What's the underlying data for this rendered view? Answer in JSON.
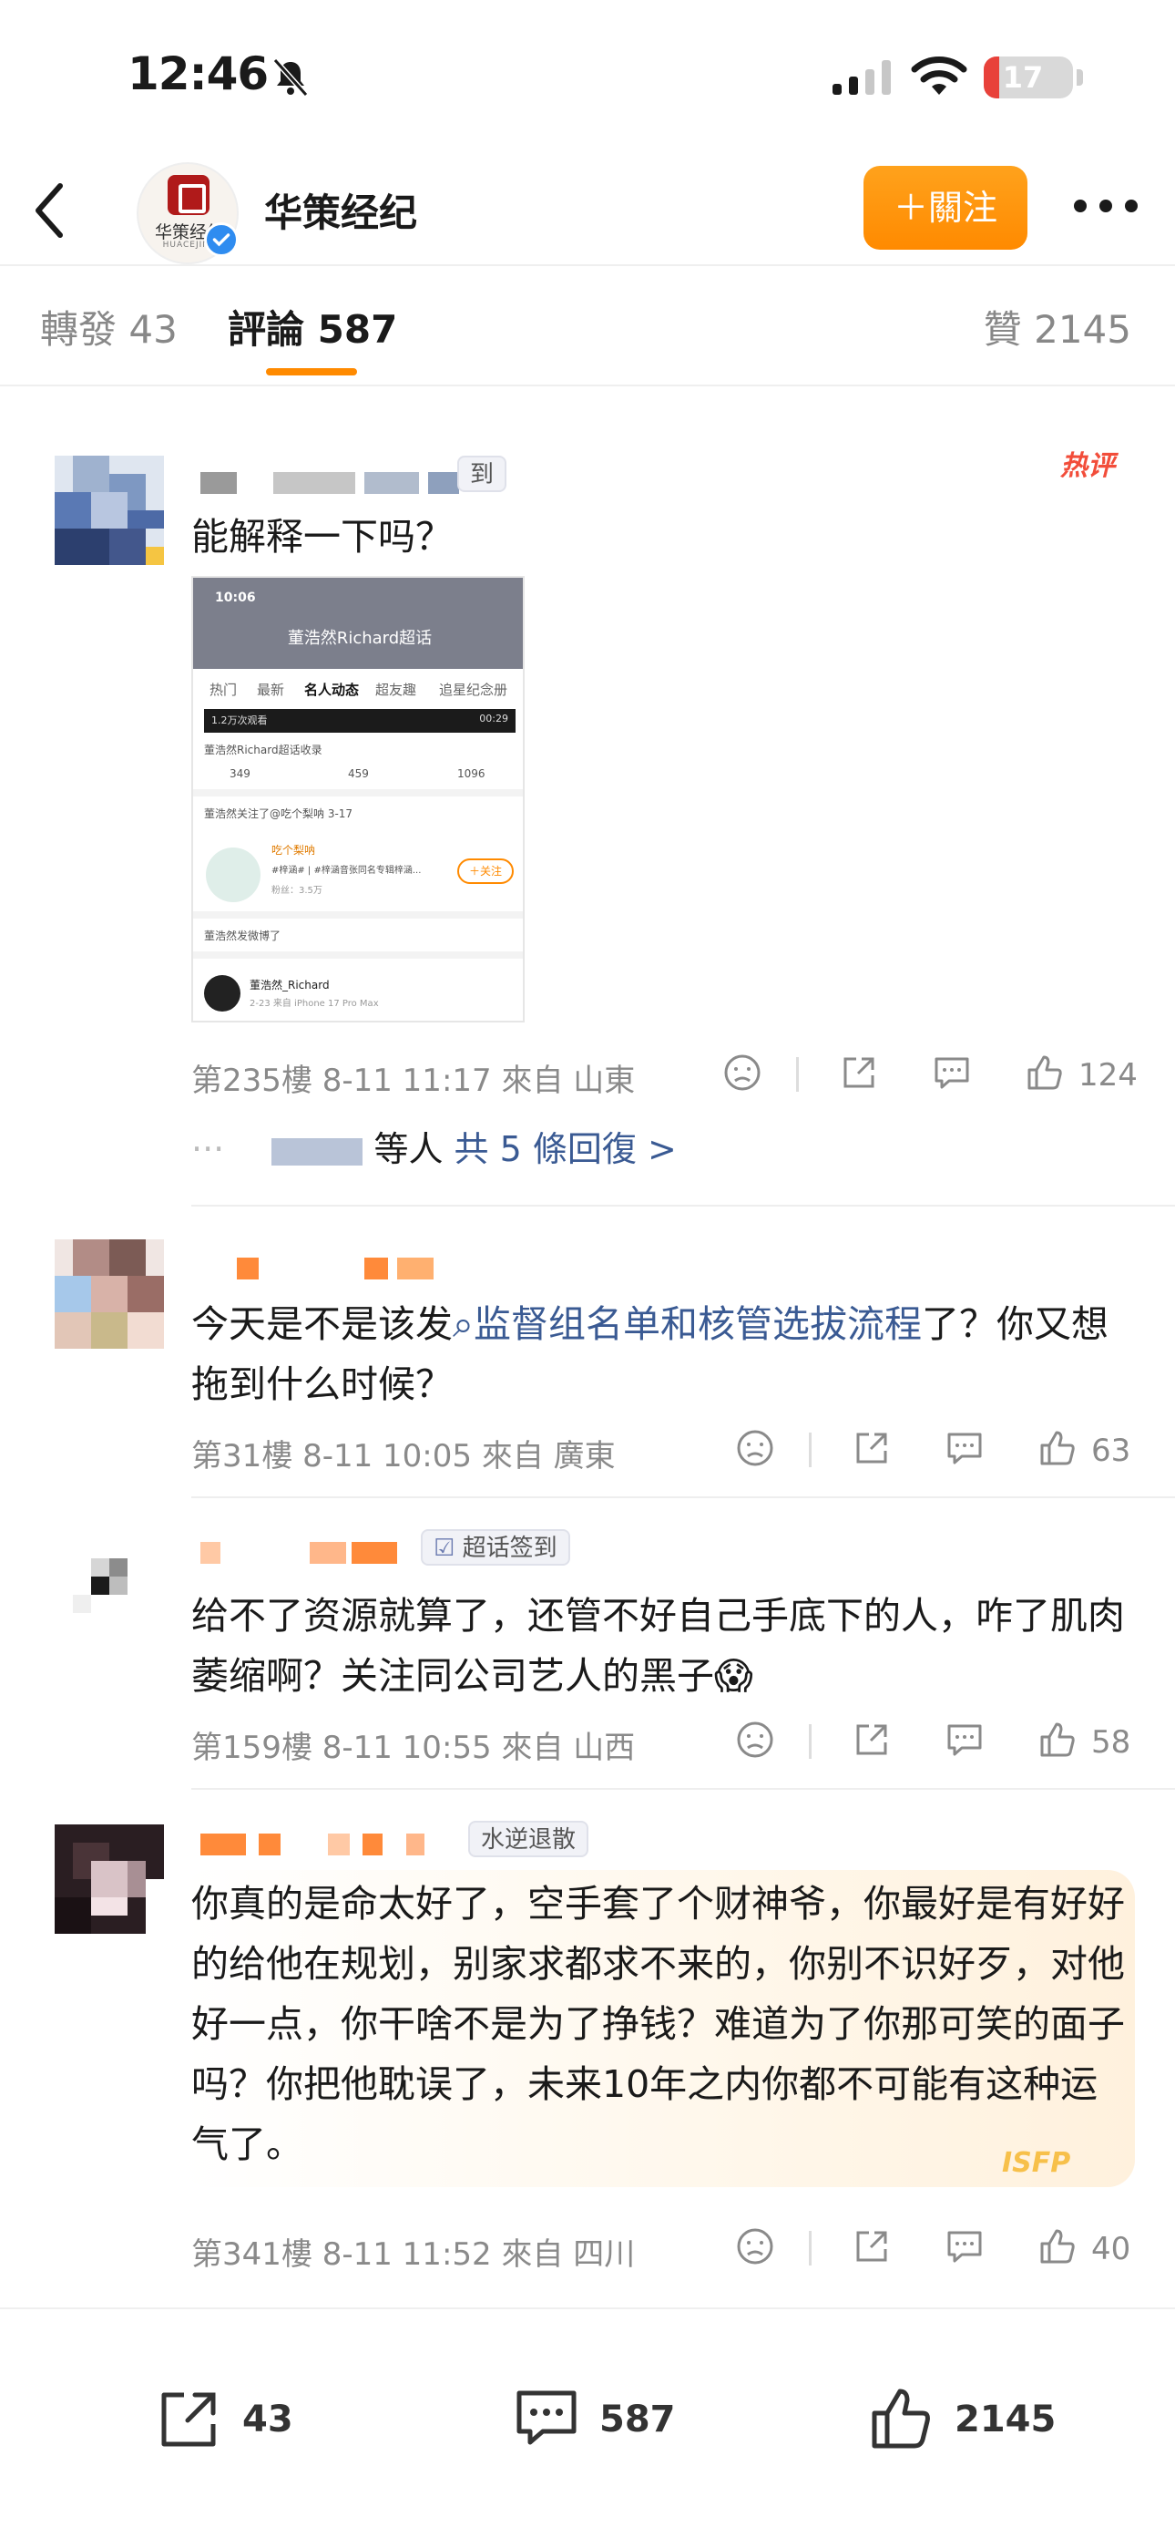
{
  "status_bar": {
    "time": "12:46",
    "battery": "17",
    "battery_level": 0.17
  },
  "header": {
    "account_name": "华策经纪",
    "logo_text": "华策经纪",
    "logo_sub": "HUACEJINJI",
    "follow_label": "＋關注"
  },
  "tabs": {
    "reposts": "轉發 43",
    "comments": "評論 587",
    "likes": "贊 2145"
  },
  "comments": [
    {
      "text": "能解释一下吗？",
      "hot_label": "热评",
      "tag": "到",
      "meta": "第235樓  8-11 11:17  來自 山東",
      "likes": "124",
      "replies_prefix": "等人",
      "replies_link": "共 5 條回復 >",
      "screenshot": {
        "time": "10:06",
        "title": "董浩然Richard超话",
        "tabs": [
          "热门",
          "最新",
          "名人动态",
          "超友趣",
          "追星纪念册"
        ],
        "video_views": "1.2万次观看",
        "video_duration": "00:29",
        "collected": "董浩然Richard超话收录",
        "stats": [
          "349",
          "459",
          "1096"
        ],
        "followed_line": "董浩然关注了@吃个梨呐 3-17",
        "followed_name": "吃个梨呐",
        "followed_desc": "#梓涵# | #梓涵音张同名专辑梓涵...",
        "followed_fans": "粉丝：3.5万",
        "follow_btn": "＋关注",
        "posted_line": "董浩然发微博了",
        "poster_name": "董浩然_Richard",
        "poster_meta": "2-23  来自 iPhone 17 Pro Max"
      }
    },
    {
      "text_before": "今天是不是该发",
      "topic": "监督组名单和核管选拔流程",
      "text_after": "了？你又想拖到什么时候？",
      "meta": "第31樓  8-11 10:05  來自 廣東",
      "likes": "63"
    },
    {
      "tag": "超话签到",
      "text": "给不了资源就算了，还管不好自己手底下的人，咋了肌肉萎缩啊？关注同公司艺人的黑子😱",
      "meta": "第159樓  8-11 10:55  來自 山西",
      "likes": "58"
    },
    {
      "tag": "水逆退散",
      "text": "你真的是命太好了，空手套了个财神爷，你最好是有好好的给他在规划，别家求都求不来的，你别不识好歹，对他好一点，你干啥不是为了挣钱？难道为了你那可笑的面子吗？你把他耽误了，未来10年之内你都不可能有这种运气了。",
      "badge": "ISFP",
      "meta": "第341樓  8-11 11:52  來自 四川",
      "likes": "40"
    }
  ],
  "bottom_bar": {
    "reposts": "43",
    "comments": "587",
    "likes": "2145"
  },
  "colors": {
    "accent": "#ff8a00",
    "link": "#3a5a93",
    "battery_low": "#e8413a",
    "verified": "#2f8cf0"
  }
}
